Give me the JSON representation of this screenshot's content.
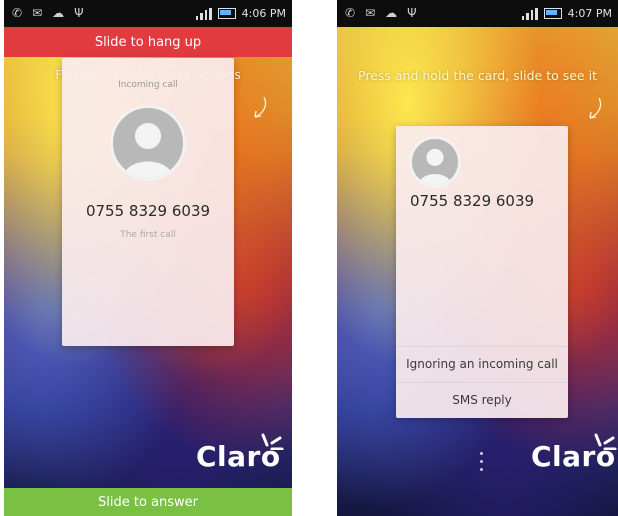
{
  "left_screen": {
    "status": {
      "time": "4:06 PM"
    },
    "hang_up_label": "Slide to hang up",
    "hint": "Flip the card for more options",
    "card": {
      "label": "Incoming call",
      "number": "0755 8329 6039",
      "subtitle": "The first call"
    },
    "brand": "Claro",
    "answer_label": "Slide to answer"
  },
  "right_screen": {
    "status": {
      "time": "4:07 PM"
    },
    "hint": "Press and hold the card, slide to see it",
    "card": {
      "number": "0755 8329 6039",
      "actions": [
        "Ignoring an incoming call",
        "SMS reply"
      ]
    },
    "brand": "Claro"
  },
  "icons": {
    "status_left": [
      "phone-icon",
      "message-icon",
      "cloud-icon",
      "usb-icon"
    ],
    "status_right": [
      "signal-icon",
      "battery-icon"
    ],
    "avatar": "person-icon",
    "swipe": "curved-arrow-icon"
  },
  "colors": {
    "hang_up": "#e23b3f",
    "answer": "#79c043",
    "status_bar": "#0d0d0d",
    "card": "#faeced"
  }
}
